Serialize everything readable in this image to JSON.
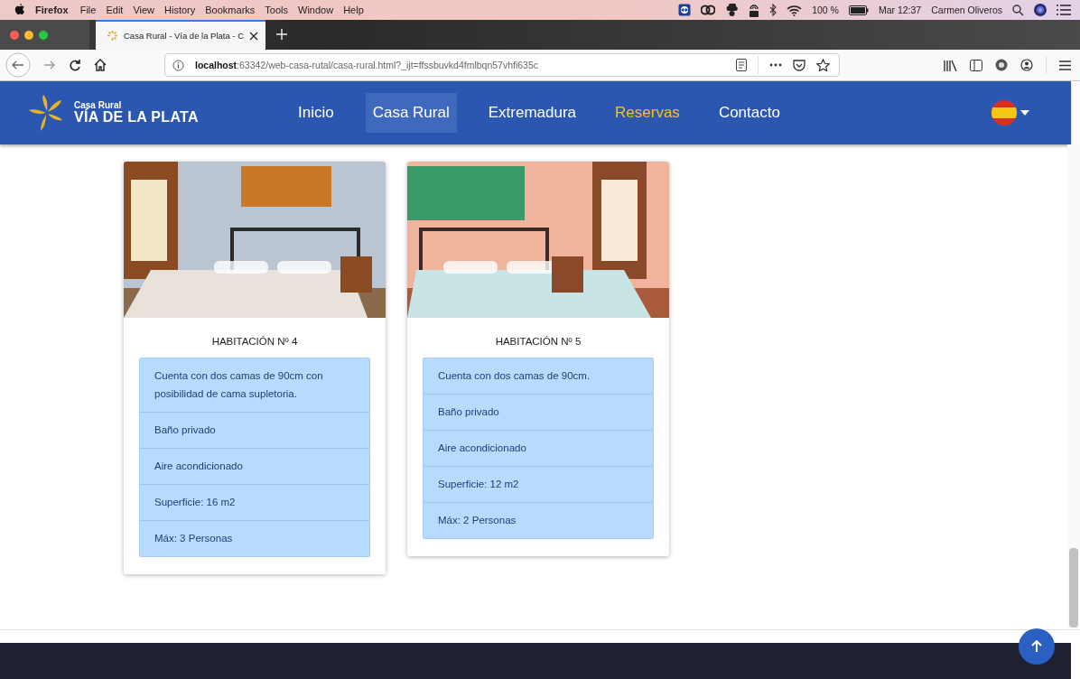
{
  "menu_bar": {
    "app": "Firefox",
    "items": [
      "File",
      "Edit",
      "View",
      "History",
      "Bookmarks",
      "Tools",
      "Window",
      "Help"
    ],
    "battery": "100 %",
    "clock": "Mar 12:37",
    "user": "Carmen Oliveros"
  },
  "tab": {
    "title": "Casa Rural - Vía de la Plata - C",
    "selected": true
  },
  "address_bar": {
    "host": "localhost",
    "path": ":63342/web-casa-rutal/casa-rural.html?_ijt=ffssbuvkd4fmlbqn57vhfi635c"
  },
  "site_nav": {
    "logo_top": "Casa Rural",
    "logo_bottom": "VÍA DE LA PLATA",
    "items": [
      {
        "label": "Inicio",
        "selected": false,
        "current": false
      },
      {
        "label": "Casa Rural",
        "selected": true,
        "current": false
      },
      {
        "label": "Extremadura",
        "selected": false,
        "current": false
      },
      {
        "label": "Reservas",
        "selected": false,
        "current": true
      },
      {
        "label": "Contacto",
        "selected": false,
        "current": false
      }
    ]
  },
  "rooms": [
    {
      "kind": "picture",
      "title": "HABITACIÓN Nº 4",
      "features": [
        "Cuenta con dos camas de 90cm con posibilidad de cama supletoria.",
        "Baño privado",
        "Aire acondicionado",
        "Superficie: 16 m2",
        "Máx: 3 Personas"
      ]
    },
    {
      "kind": "picture",
      "title": "HABITACIÓN Nº 5",
      "features": [
        "Cuenta con dos camas de 90cm.",
        "Baño privado",
        "Aire acondicionado",
        "Superficie: 12 m2",
        "Máx: 2 Personas"
      ]
    }
  ]
}
